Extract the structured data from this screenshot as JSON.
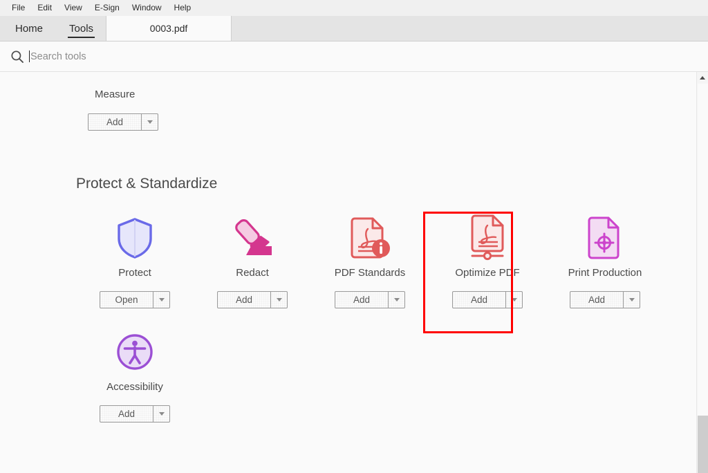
{
  "menubar": {
    "items": [
      {
        "label": "File",
        "name": "menu-file"
      },
      {
        "label": "Edit",
        "name": "menu-edit"
      },
      {
        "label": "View",
        "name": "menu-view"
      },
      {
        "label": "E-Sign",
        "name": "menu-esign"
      },
      {
        "label": "Window",
        "name": "menu-window"
      },
      {
        "label": "Help",
        "name": "menu-help"
      }
    ]
  },
  "tabs": {
    "home": "Home",
    "tools": "Tools",
    "document": "0003.pdf"
  },
  "search": {
    "placeholder": "Search tools",
    "value": "",
    "icon": "search-icon"
  },
  "partial_section": {
    "title": "Measure",
    "button": {
      "label": "Add",
      "dropdown": "chevron-down-icon"
    }
  },
  "section": {
    "title": "Protect & Standardize"
  },
  "tools": [
    {
      "label": "Protect",
      "icon": "shield-icon",
      "button": "Open",
      "dropdown": "chevron-down-icon",
      "highlighted": false,
      "color": "#6a6ae8"
    },
    {
      "label": "Redact",
      "icon": "marker-pen-icon",
      "button": "Add",
      "dropdown": "chevron-down-icon",
      "highlighted": false,
      "color": "#d4368e"
    },
    {
      "label": "PDF Standards",
      "icon": "pdf-info-document-icon",
      "button": "Add",
      "dropdown": "chevron-down-icon",
      "highlighted": false,
      "color": "#e05a5a"
    },
    {
      "label": "Optimize PDF",
      "icon": "pdf-optimize-document-icon",
      "button": "Add",
      "dropdown": "chevron-down-icon",
      "highlighted": true,
      "color": "#e05a5a"
    },
    {
      "label": "Print Production",
      "icon": "print-production-document-icon",
      "button": "Add",
      "dropdown": "chevron-down-icon",
      "highlighted": false,
      "color": "#cc44cc"
    },
    {
      "label": "Accessibility",
      "icon": "accessibility-icon",
      "button": "Add",
      "dropdown": "chevron-down-icon",
      "highlighted": false,
      "color": "#9b4fd4"
    }
  ],
  "highlight": {
    "color": "#ff0000"
  },
  "scrollbar": {
    "up_arrow": "scroll-up-arrow-icon"
  }
}
